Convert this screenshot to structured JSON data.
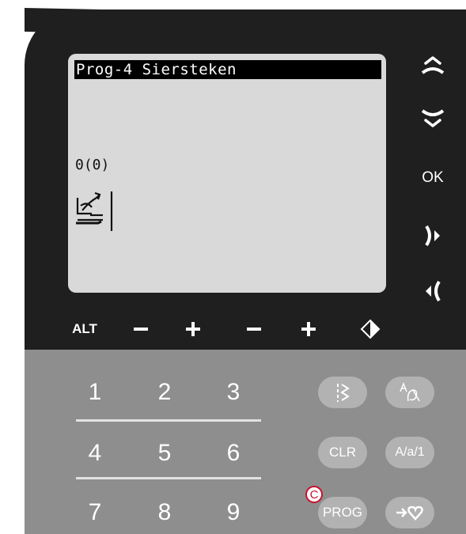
{
  "lcd": {
    "title": "Prog-4 Siersteken",
    "counter": "0(0)",
    "stitch_icon": "decorative-stitch-icon"
  },
  "side_buttons": {
    "up_icon": "arrow-up-icon",
    "down_icon": "arrow-down-icon",
    "ok_label": "OK",
    "right_icon": "scroll-right-icon",
    "left_icon": "scroll-left-icon"
  },
  "bottom_row": {
    "alt_label": "ALT",
    "minus_1": "−",
    "plus_1": "+",
    "minus_2": "−",
    "plus_2": "+",
    "mirror_icon": "mirror-icon"
  },
  "keypad": {
    "keys": [
      "1",
      "2",
      "3",
      "4",
      "5",
      "6",
      "7",
      "8",
      "9"
    ]
  },
  "function_buttons": {
    "stitch_menu_icon": "stitch-menu-icon",
    "font_menu_icon": "font-menu-icon",
    "clr_label": "CLR",
    "case_label": "A/a/1",
    "prog_label": "PROG",
    "favorite_icon": "add-favorite-icon"
  },
  "callout": {
    "label": "C",
    "color": "#c8102e"
  },
  "colors": {
    "panel_dark": "#1f1f1f",
    "panel_grey": "#8e8e8e",
    "lcd_bg": "#d9d9d9",
    "button_grey": "#b2b2b2"
  }
}
